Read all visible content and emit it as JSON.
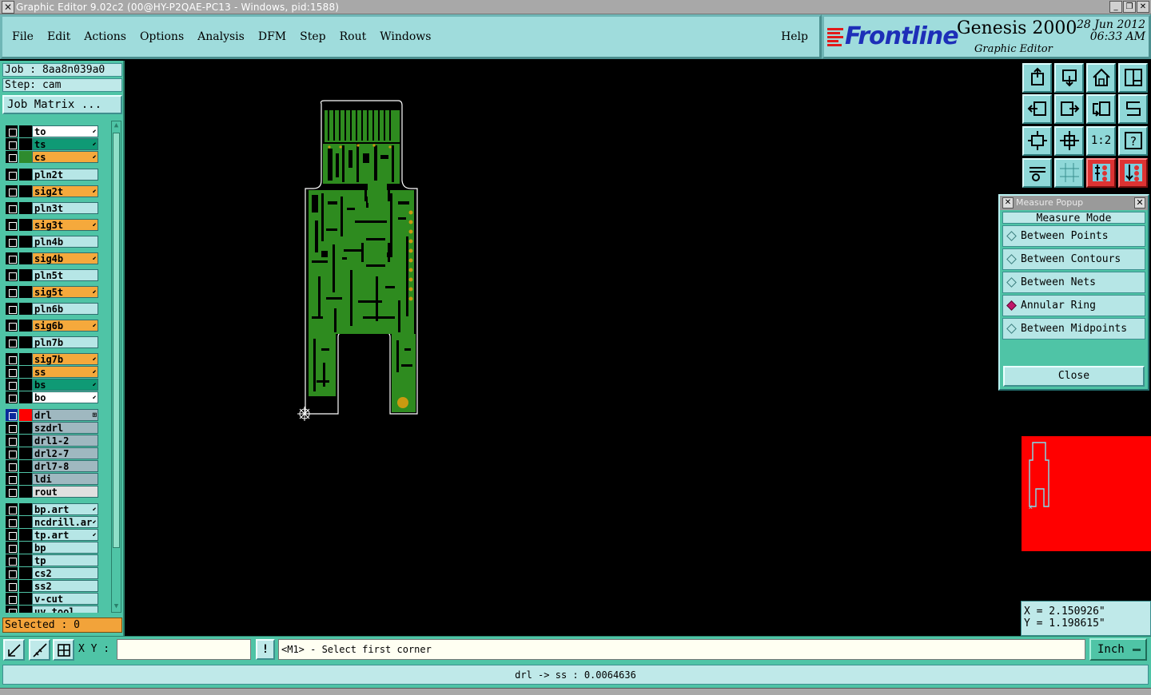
{
  "window": {
    "title": "Graphic Editor 9.02c2 (00@HY-P2QAE-PC13 - Windows, pid:1588)",
    "buttons": [
      "_",
      "❐",
      "✕"
    ]
  },
  "menu": {
    "items": [
      "File",
      "Edit",
      "Actions",
      "Options",
      "Analysis",
      "DFM",
      "Step",
      "Rout",
      "Windows"
    ],
    "help": "Help"
  },
  "brand": {
    "logo": "Frontline",
    "product": "Genesis 2000",
    "subtitle": "Graphic Editor",
    "date": "28 Jun 2012",
    "time": "06:33 AM"
  },
  "job": {
    "job_line": "Job : 8aa8n039a0",
    "step_line": "Step: cam",
    "matrix_button": "Job Matrix ..."
  },
  "layers": [
    {
      "name": "to",
      "color": "#ffffff",
      "swatch": "#000000",
      "arrow": true
    },
    {
      "name": "ts",
      "color": "#0f9a75",
      "swatch": "#000000",
      "arrow": true
    },
    {
      "name": "cs",
      "color": "#f5a93c",
      "swatch": "#2e8b2e",
      "arrow": true
    },
    {
      "name": "pln2t",
      "color": "#b6e6e6",
      "swatch": "#000000",
      "arrow": false
    },
    {
      "name": "sig2t",
      "color": "#f5a93c",
      "swatch": "#000000",
      "arrow": true
    },
    {
      "name": "pln3t",
      "color": "#b6e6e6",
      "swatch": "#000000",
      "arrow": false
    },
    {
      "name": "sig3t",
      "color": "#f5a93c",
      "swatch": "#000000",
      "arrow": true
    },
    {
      "name": "pln4b",
      "color": "#b6e6e6",
      "swatch": "#000000",
      "arrow": false
    },
    {
      "name": "sig4b",
      "color": "#f5a93c",
      "swatch": "#000000",
      "arrow": true
    },
    {
      "name": "pln5t",
      "color": "#b6e6e6",
      "swatch": "#000000",
      "arrow": false
    },
    {
      "name": "sig5t",
      "color": "#f5a93c",
      "swatch": "#000000",
      "arrow": true
    },
    {
      "name": "pln6b",
      "color": "#b6e6e6",
      "swatch": "#000000",
      "arrow": false
    },
    {
      "name": "sig6b",
      "color": "#f5a93c",
      "swatch": "#000000",
      "arrow": true
    },
    {
      "name": "pln7b",
      "color": "#b6e6e6",
      "swatch": "#000000",
      "arrow": false
    },
    {
      "name": "sig7b",
      "color": "#f5a93c",
      "swatch": "#000000",
      "arrow": true
    },
    {
      "name": "ss",
      "color": "#f5a93c",
      "swatch": "#000000",
      "arrow": true
    },
    {
      "name": "bs",
      "color": "#0f9a75",
      "swatch": "#000000",
      "arrow": true
    },
    {
      "name": "bo",
      "color": "#ffffff",
      "swatch": "#000000",
      "arrow": true
    },
    {
      "name": "drl",
      "color": "#9fb8c0",
      "swatch": "#ff0000",
      "arrow": false,
      "active": true
    },
    {
      "name": "szdrl",
      "color": "#9fb8c0",
      "swatch": "#000000",
      "arrow": false
    },
    {
      "name": "drl1-2",
      "color": "#9fb8c0",
      "swatch": "#000000",
      "arrow": false
    },
    {
      "name": "drl2-7",
      "color": "#9fb8c0",
      "swatch": "#000000",
      "arrow": false
    },
    {
      "name": "drl7-8",
      "color": "#9fb8c0",
      "swatch": "#000000",
      "arrow": false
    },
    {
      "name": "ldi",
      "color": "#9fb8c0",
      "swatch": "#000000",
      "arrow": false
    },
    {
      "name": "rout",
      "color": "#e0e0e0",
      "swatch": "#000000",
      "arrow": false
    },
    {
      "name": "bp.art",
      "color": "#b6e6e6",
      "swatch": "#000000",
      "arrow": true
    },
    {
      "name": "ncdrill.ar",
      "color": "#b6e6e6",
      "swatch": "#000000",
      "arrow": true
    },
    {
      "name": "tp.art",
      "color": "#b6e6e6",
      "swatch": "#000000",
      "arrow": true
    },
    {
      "name": "bp",
      "color": "#b6e6e6",
      "swatch": "#000000",
      "arrow": false
    },
    {
      "name": "tp",
      "color": "#b6e6e6",
      "swatch": "#000000",
      "arrow": false
    },
    {
      "name": "cs2",
      "color": "#b6e6e6",
      "swatch": "#000000",
      "arrow": false
    },
    {
      "name": "ss2",
      "color": "#b6e6e6",
      "swatch": "#000000",
      "arrow": false
    },
    {
      "name": "v-cut",
      "color": "#b6e6e6",
      "swatch": "#000000",
      "arrow": false
    },
    {
      "name": "uv tool",
      "color": "#b6e6e6",
      "swatch": "#000000",
      "arrow": false
    }
  ],
  "selected": "Selected : 0",
  "measure": {
    "title": "Measure Popup",
    "mode_label": "Measure Mode",
    "options": [
      {
        "label": "Between Points",
        "on": false
      },
      {
        "label": "Between Contours",
        "on": false
      },
      {
        "label": "Between Nets",
        "on": false
      },
      {
        "label": "Annular Ring",
        "on": true
      },
      {
        "label": "Between Midpoints",
        "on": false
      }
    ],
    "close": "Close"
  },
  "toolbar_icons": [
    "zoom-home-icon",
    "zoom-down-icon",
    "home-icon",
    "window-icon",
    "pan-left-icon",
    "pan-right-icon",
    "undo-zoom-icon",
    "redraw-icon",
    "fit-icon",
    "center-icon",
    "scale-icon",
    "help-icon",
    "settings-icon",
    "grid-icon",
    "layer-swap-icon",
    "layer-order-icon"
  ],
  "toolbar_labels": {
    "scale": "1:2",
    "help": "?"
  },
  "coords": {
    "x": "X = 2.150926\"",
    "y": "Y = 1.198615\""
  },
  "bottom": {
    "xy_label": "X Y :",
    "xy_value": "",
    "bang": "!",
    "prompt": "<M1> - Select first corner",
    "units": "Inch"
  },
  "status": "drl -> ss : 0.0064636",
  "colors": {
    "teal": "#4fc4a6",
    "light": "#bfe9e9",
    "board": "#2e8b1f",
    "selected": "#f2a33a"
  }
}
